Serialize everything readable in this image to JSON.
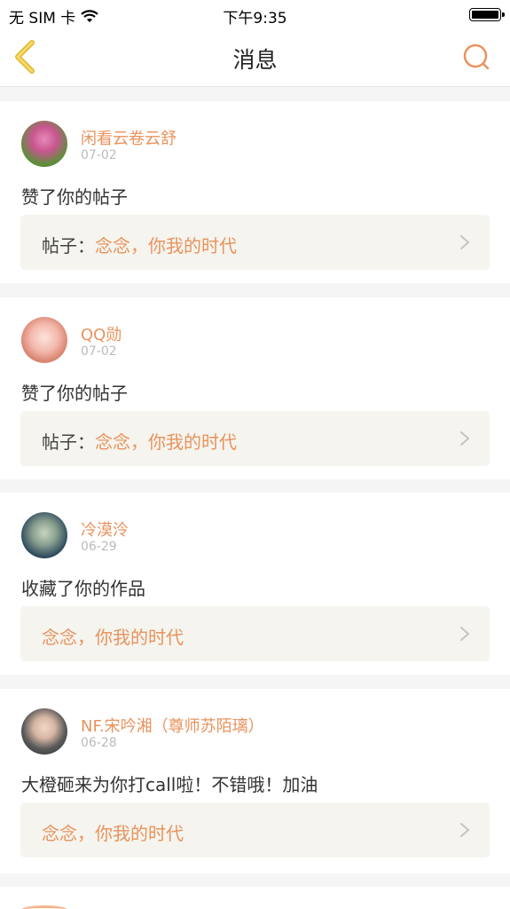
{
  "status_bar": {
    "carrier": "无 SIM 卡",
    "time": "下午9:35"
  },
  "nav": {
    "title": "消息"
  },
  "messages": [
    {
      "user": "闲看云卷云舒",
      "date": "07-02",
      "action": "赞了你的帖子",
      "ref_prefix": "帖子：",
      "ref_title": "念念，你我的时代"
    },
    {
      "user": "QQ勋",
      "date": "07-02",
      "action": "赞了你的帖子",
      "ref_prefix": "帖子：",
      "ref_title": "念念，你我的时代"
    },
    {
      "user": "冷漠泠",
      "date": "06-29",
      "action": "收藏了你的作品",
      "ref_prefix": "",
      "ref_title": "念念，你我的时代"
    },
    {
      "user": "NF.宋吟湘（尊师苏陌璃）",
      "date": "06-28",
      "action": "大橙砸来为你打call啦！不错哦！加油",
      "ref_prefix": "",
      "ref_title": "念念，你我的时代"
    }
  ],
  "colors": {
    "accent": "#e8935e",
    "back_arrow": "#f2c94c",
    "card_ref_bg": "#f5f4ee"
  }
}
